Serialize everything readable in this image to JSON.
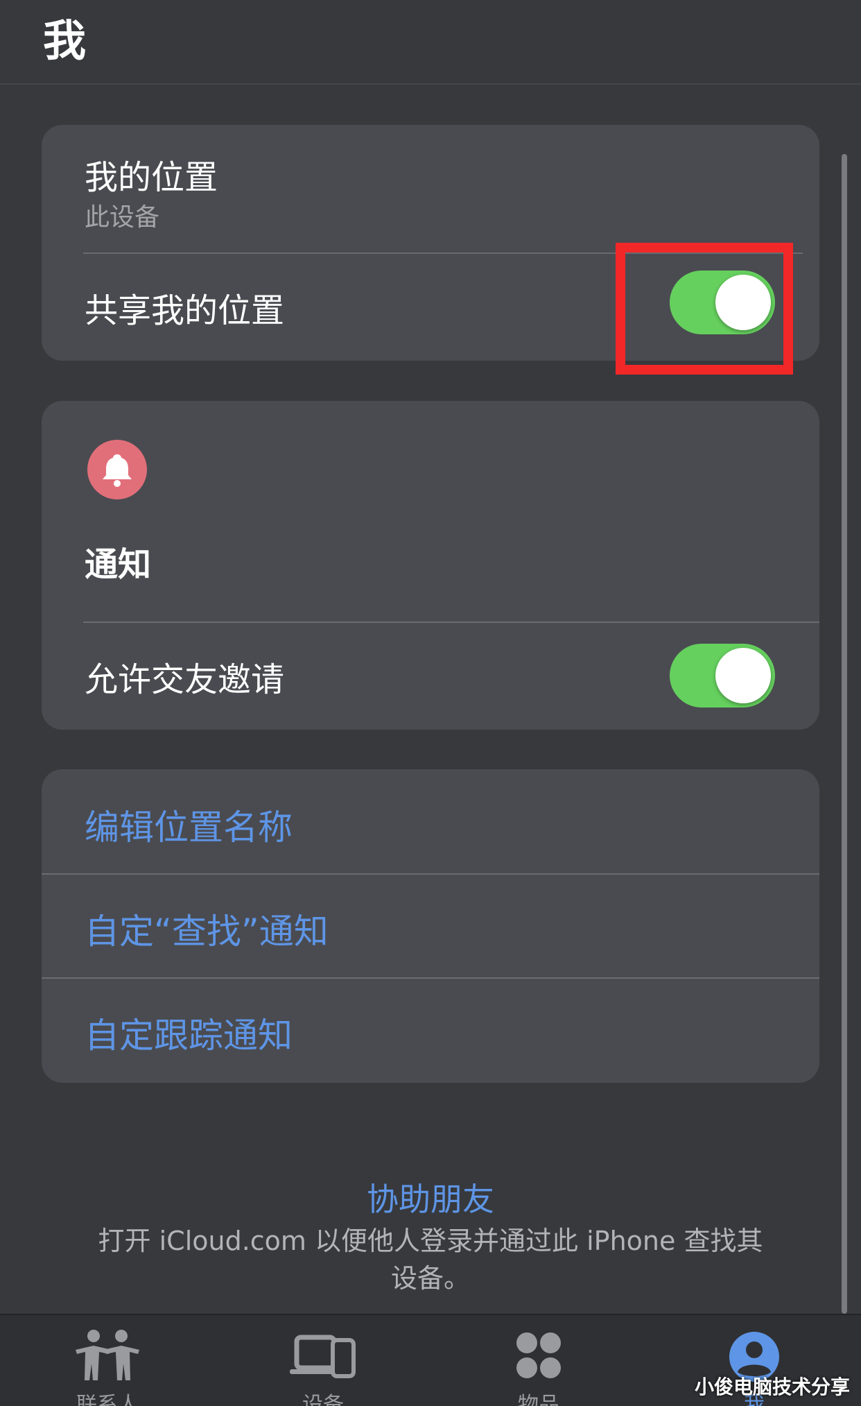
{
  "header": {
    "title": "我"
  },
  "my_location": {
    "title": "我的位置",
    "subtitle": "此设备",
    "share_label": "共享我的位置",
    "share_enabled": true
  },
  "notifications": {
    "icon": "bell-icon",
    "title": "通知",
    "allow_friend_requests_label": "允许交友邀请",
    "allow_friend_requests_enabled": true
  },
  "links": {
    "edit_location_name": "编辑位置名称",
    "custom_find_notifications": "自定“查找”通知",
    "custom_tracking_notifications": "自定跟踪通知"
  },
  "help": {
    "title": "协助朋友",
    "description": "打开 iCloud.com 以便他人登录并通过此 iPhone 查找其设备。"
  },
  "tabs": [
    {
      "label": "联系人",
      "icon": "people-icon",
      "active": false
    },
    {
      "label": "设备",
      "icon": "devices-icon",
      "active": false
    },
    {
      "label": "物品",
      "icon": "items-icon",
      "active": false
    },
    {
      "label": "我",
      "icon": "person-icon",
      "active": true
    }
  ],
  "watermark": "小俊电脑技术分享",
  "colors": {
    "background": "#37393d",
    "card": "#4a4b50",
    "accent": "#5e95e6",
    "toggle_on": "#65d05e",
    "highlight": "#f22828",
    "bell": "#e16f7a"
  }
}
